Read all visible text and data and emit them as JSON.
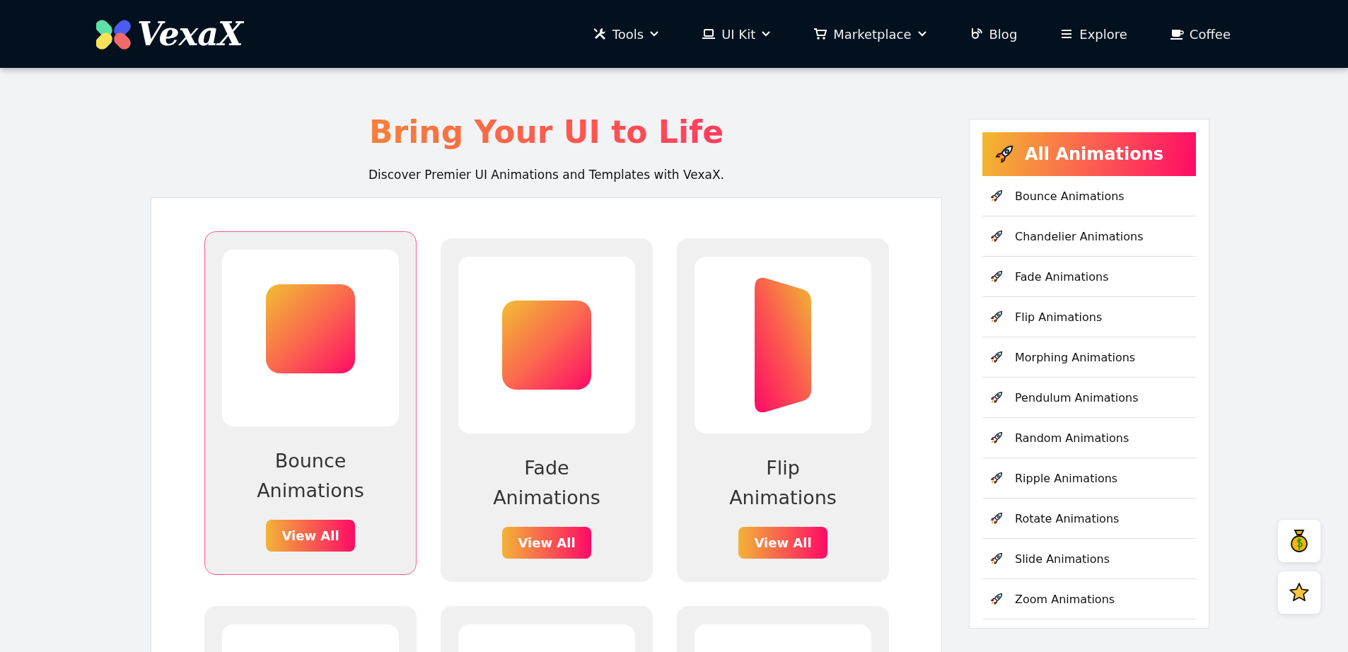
{
  "logo": {
    "text": "VexaX"
  },
  "nav": [
    {
      "label": "Tools",
      "kind": "tools",
      "dropdown": true
    },
    {
      "label": "UI Kit",
      "kind": "laptop",
      "dropdown": true
    },
    {
      "label": "Marketplace",
      "kind": "cart",
      "dropdown": true
    },
    {
      "label": "Blog",
      "kind": "blog",
      "dropdown": false
    },
    {
      "label": "Explore",
      "kind": "list",
      "dropdown": false
    },
    {
      "label": "Coffee",
      "kind": "cup",
      "dropdown": false
    }
  ],
  "hero": {
    "title": "Bring Your UI to Life",
    "subtitle": "Discover Premier UI Animations and Templates with VexaX."
  },
  "cards": [
    {
      "title": "Bounce Animations",
      "kind": "bounce",
      "button": "View All",
      "selected": true
    },
    {
      "title": "Fade Animations",
      "kind": "fade",
      "button": "View All",
      "selected": false
    },
    {
      "title": "Flip Animations",
      "kind": "flip",
      "button": "View All",
      "selected": false
    }
  ],
  "sidebar": {
    "title": "All Animations",
    "items": [
      "Bounce Animations",
      "Chandelier Animations",
      "Fade Animations",
      "Flip Animations",
      "Morphing Animations",
      "Pendulum Animations",
      "Random Animations",
      "Ripple Animations",
      "Rotate Animations",
      "Slide Animations",
      "Zoom Animations"
    ]
  }
}
